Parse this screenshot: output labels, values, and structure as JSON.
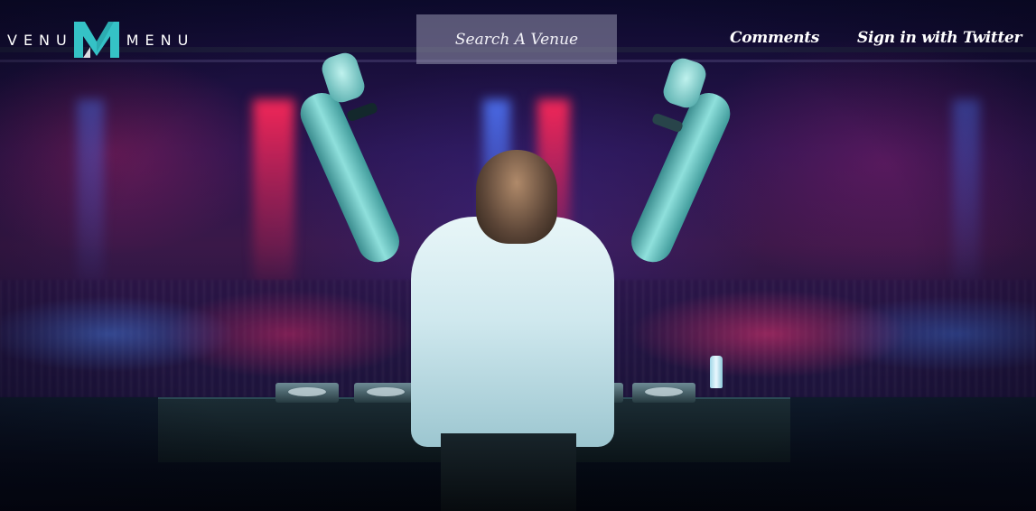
{
  "header": {
    "logo": {
      "left_text": "VENU",
      "mark_letter": "M",
      "right_text": "MENU",
      "mark_color": "#35c2c6"
    },
    "search": {
      "placeholder": "Search A Venue",
      "value": ""
    },
    "nav": {
      "comments_label": "Comments",
      "signin_label": "Sign in with Twitter"
    }
  },
  "hero": {
    "image_subject": "dj-performing-to-crowd",
    "colors": {
      "accent_teal": "#8fe0dc",
      "stage_red": "#ff2a5a",
      "stage_blue": "#5078ff",
      "background_dark": "#0a0a22"
    }
  }
}
